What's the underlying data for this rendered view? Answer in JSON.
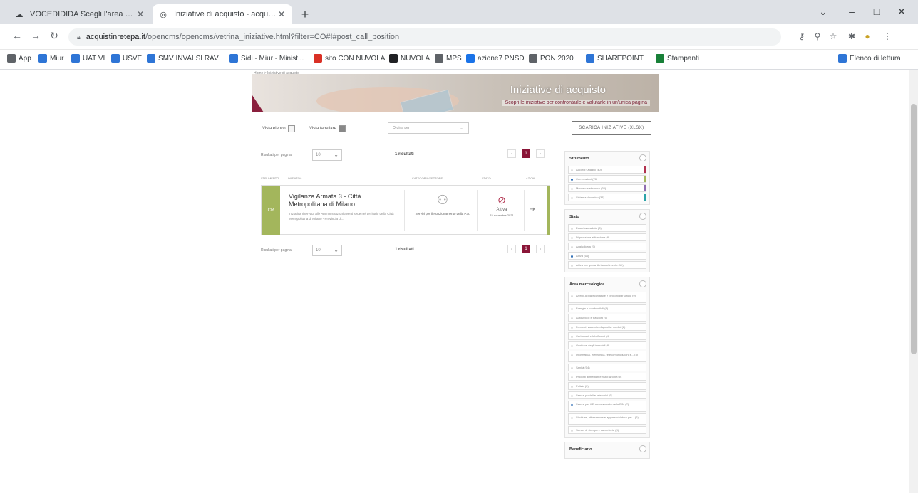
{
  "browser": {
    "tabs": [
      {
        "label": "VOCEDIDIDA Scegli l'area di lavo",
        "icon": "cloud-icon",
        "active": false
      },
      {
        "label": "Iniziative di acquisto - acquisti",
        "icon": "globe-icon",
        "active": true
      }
    ],
    "url_domain": "acquistinretepa.it",
    "url_path": "/opencms/opencms/vetrina_iniziative.html?filter=CO#!#post_call_position",
    "bookmarks": [
      {
        "label": "App",
        "color": "#5f6368"
      },
      {
        "label": "Miur",
        "color": "#2e75d6"
      },
      {
        "label": "UAT VI",
        "color": "#2e75d6"
      },
      {
        "label": "USVE",
        "color": "#2e75d6"
      },
      {
        "label": "SMV INVALSI RAV",
        "color": "#2e75d6"
      },
      {
        "label": "Sidi - Miur - Minist...",
        "color": "#2e75d6"
      },
      {
        "label": "sito CON NUVOLA",
        "color": "#d93025"
      },
      {
        "label": "NUVOLA",
        "color": "#202124"
      },
      {
        "label": "MPS",
        "color": "#5f6368"
      },
      {
        "label": "azione7 PNSD",
        "color": "#1a73e8"
      },
      {
        "label": "PON 2020",
        "color": "#5f6368"
      },
      {
        "label": "SHAREPOINT",
        "color": "#2e75d6"
      },
      {
        "label": "Stampanti",
        "color": "#188038"
      }
    ],
    "reading_list": "Elenco di lettura"
  },
  "page": {
    "breadcrumb": "Home > Iniziative di acquisto",
    "banner_title": "Iniziative di acquisto",
    "banner_subtitle": "Scopri le iniziative per confrontarle e valutarle in un'unica pagina",
    "view_list_label": "Vista elenco",
    "view_grid_label": "Vista tabellare",
    "sort_placeholder": "Ordina per",
    "download_label": "SCARICA INIZIATIVE (XLSX)",
    "per_page_label": "Risultati per pagina",
    "per_page_value": "10",
    "results_label": "1 risultati",
    "current_page": "1",
    "table_headers": [
      "STRUMENTO",
      "INIZIATIVA",
      "CATEGORIA/SETTORE",
      "STATO",
      "AZIONI"
    ],
    "card": {
      "stripe_label": "CR",
      "title": "Vigilanza Armata 3 - Città Metropolitana di Milano",
      "description": "Iniziativa riservata alle Amministrazioni aventi sede nel territorio della Città Metropolitana di Milano - Provincia di...",
      "category": "Servizi per il Funzionamento della P.A.",
      "status": "Attiva",
      "status_date": "15 novembre 2021"
    }
  },
  "filters": [
    {
      "title": "Strumento",
      "items": [
        {
          "label": "Accordi Quadro (40)",
          "selected": false,
          "color": "#b1304d"
        },
        {
          "label": "Convenzioni (78)",
          "selected": true,
          "color": "#a3b65c"
        },
        {
          "label": "Mercato elettronico (34)",
          "selected": false,
          "color": "#8e6cb0"
        },
        {
          "label": "Sistema dinamico (33)",
          "selected": false,
          "color": "#2aa3a8"
        }
      ]
    },
    {
      "title": "Stato",
      "items": [
        {
          "label": "Esaurita/scaduta (8)",
          "selected": false
        },
        {
          "label": "Di prossima attivazione (8)",
          "selected": false
        },
        {
          "label": "Aggiudicata (9)",
          "selected": false
        },
        {
          "label": "Attiva (64)",
          "selected": true
        },
        {
          "label": "Attiva per quota di riassortimento (10)",
          "selected": false
        }
      ]
    },
    {
      "title": "Area merceologica",
      "items": [
        {
          "label": "Arredi, Apparecchiature e prodotti per ufficio (9)",
          "selected": false,
          "two": true
        },
        {
          "label": "Energia e combustibili (6)",
          "selected": false
        },
        {
          "label": "Autoveicoli e trasporti (5)",
          "selected": false
        },
        {
          "label": "Farmaci, vaccini e dispositivi medici (8)",
          "selected": false
        },
        {
          "label": "Carburanti e lubrificanti (4)",
          "selected": false
        },
        {
          "label": "Gestione degli immobili (8)",
          "selected": false
        },
        {
          "label": "Informatica, elettronica, telecomunicazioni e... (8)",
          "selected": false,
          "two": true
        },
        {
          "label": "Sanità (14)",
          "selected": false
        },
        {
          "label": "Prodotti alimentari e ristorazione (8)",
          "selected": false
        },
        {
          "label": "Pulizia (2)",
          "selected": false
        },
        {
          "label": "Servizi postali e telefonici (6)",
          "selected": false
        },
        {
          "label": "Servizi per il Funzionamento della P.A. (7)",
          "selected": true,
          "two": true
        },
        {
          "label": "Strutture, attrezzature e apparecchiature per... (6)",
          "selected": false,
          "two": true
        },
        {
          "label": "Servizi di stampa e cancelleria (3)",
          "selected": false
        }
      ]
    },
    {
      "title": "Beneficiario",
      "items": []
    }
  ]
}
